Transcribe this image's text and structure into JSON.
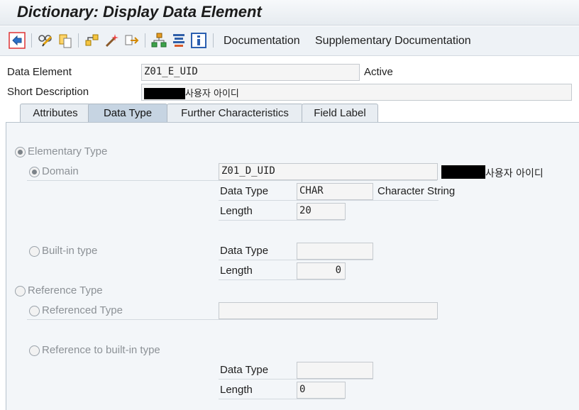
{
  "window": {
    "title": "Dictionary: Display Data Element"
  },
  "toolbar": {
    "icons": [
      "back-icon",
      "display-change-icon",
      "copy-object-icon",
      "where-used-icon",
      "activate-icon",
      "navigation-icon",
      "hierarchy-icon",
      "list-icon",
      "info-icon"
    ],
    "documentation_label": "Documentation",
    "supplementary_label": "Supplementary Documentation"
  },
  "header": {
    "data_element_label": "Data Element",
    "data_element_value": "Z01_E_UID",
    "status": "Active",
    "short_desc_label": "Short Description",
    "short_desc_value": "사용자 아이디"
  },
  "tabs": [
    {
      "label": "Attributes",
      "active": false
    },
    {
      "label": "Data Type",
      "active": true
    },
    {
      "label": "Further Characteristics",
      "active": false
    },
    {
      "label": "Field Label",
      "active": false
    }
  ],
  "data_type_tab": {
    "elementary_type": {
      "label": "Elementary Type",
      "selected": true
    },
    "domain": {
      "label": "Domain",
      "selected": true,
      "value": "Z01_D_UID",
      "description": "사용자 아이디",
      "data_type_label": "Data Type",
      "data_type_value": "CHAR",
      "data_type_desc": "Character String",
      "length_label": "Length",
      "length_value": "20"
    },
    "builtin_type": {
      "label": "Built-in type",
      "selected": false,
      "data_type_label": "Data Type",
      "data_type_value": "",
      "length_label": "Length",
      "length_value": "0"
    },
    "reference_type": {
      "label": "Reference Type",
      "selected": false
    },
    "referenced_type": {
      "label": "Referenced Type",
      "selected": false,
      "value": ""
    },
    "reference_builtin": {
      "label": "Reference to built-in type",
      "selected": false,
      "data_type_label": "Data Type",
      "data_type_value": "",
      "length_label": "Length",
      "length_value": "0"
    }
  },
  "colors": {
    "panel_bg": "#f3f6f9",
    "active_tab": "#c6d4e2",
    "toolbar_bg": "#eef2f6"
  }
}
